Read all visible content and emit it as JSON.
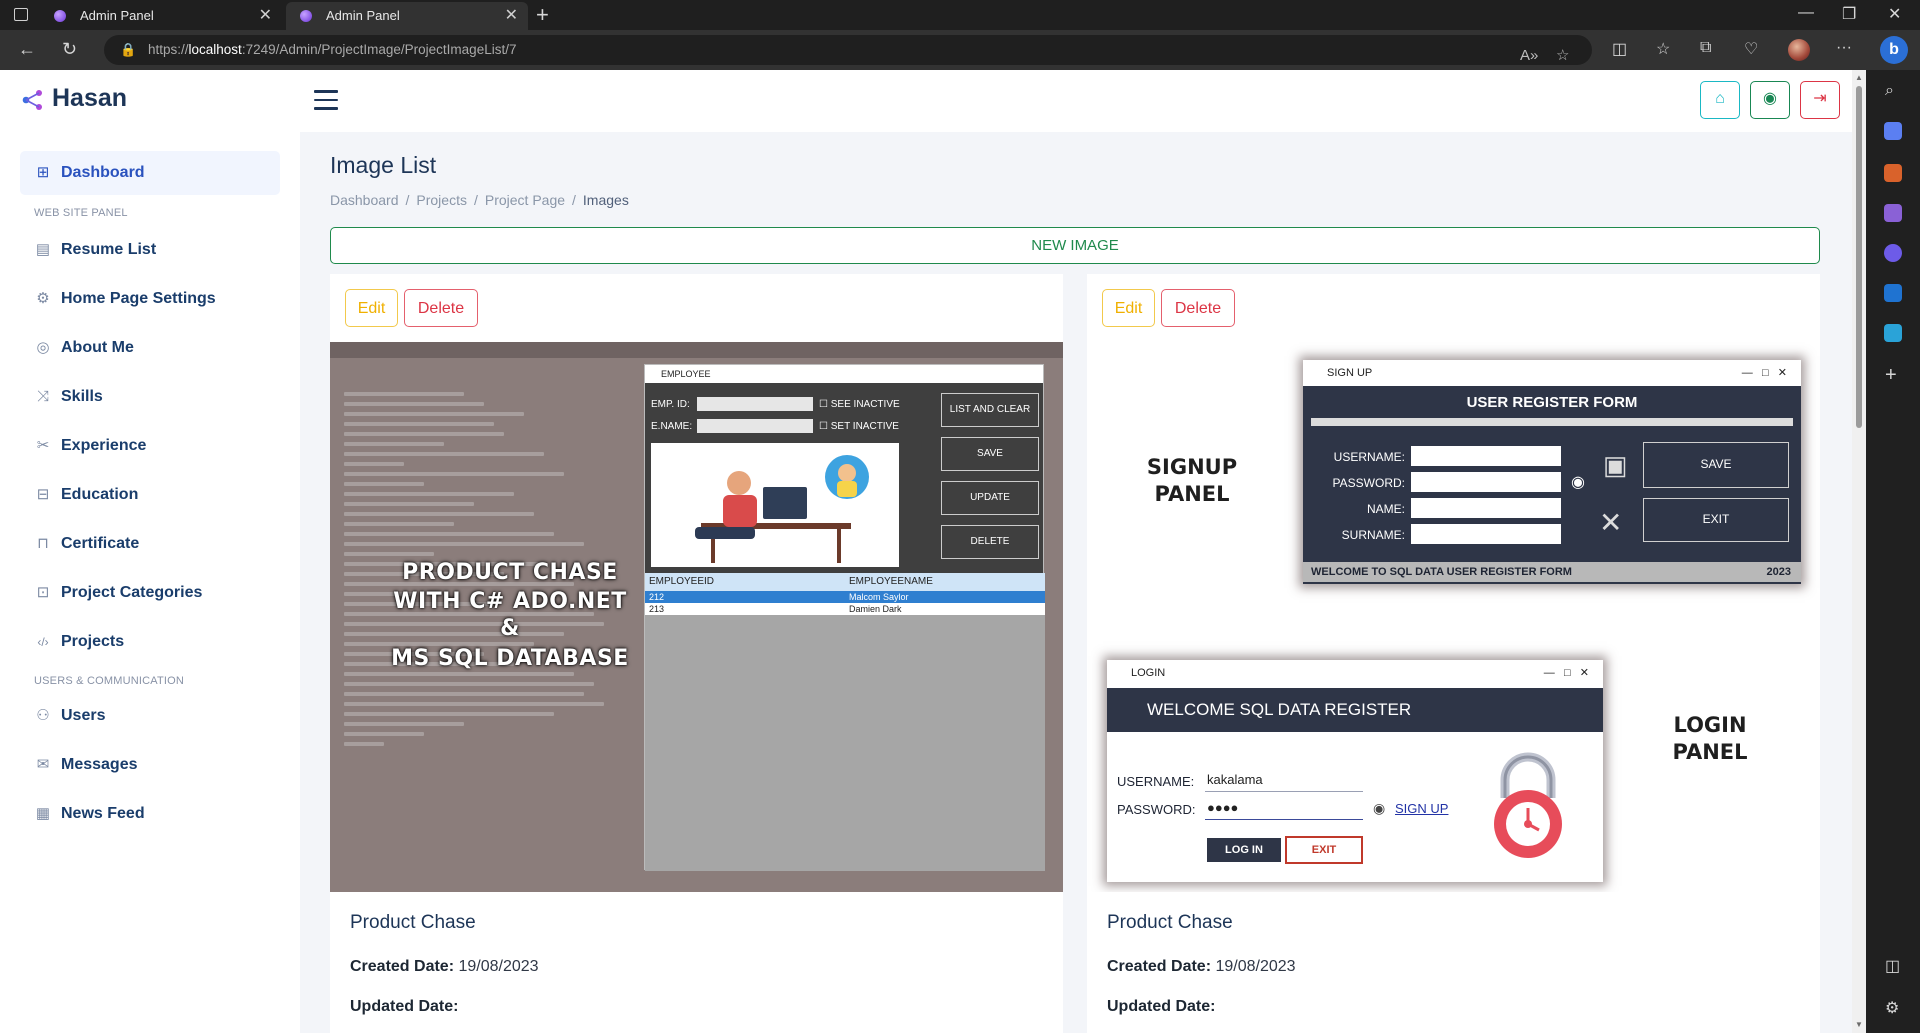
{
  "browser": {
    "tabs": [
      {
        "title": "Admin Panel",
        "active": false
      },
      {
        "title": "Admin Panel",
        "active": true
      }
    ],
    "url_scheme": "https://",
    "url_host": "localhost",
    "url_path": ":7249/Admin/ProjectImage/ProjectImageList/7",
    "icons": [
      "back-icon",
      "refresh-icon",
      "lock-icon",
      "read-aloud-icon",
      "favorite-icon",
      "split-screen-icon",
      "favorites-icon",
      "collections-icon",
      "performance-icon",
      "profile-avatar",
      "more-icon",
      "bing-icon"
    ]
  },
  "header": {
    "brand": "Hasan",
    "buttons": [
      {
        "name": "home-button",
        "icon": "home-icon",
        "color": "#1ab8c4",
        "glyph": "⌂"
      },
      {
        "name": "profile-button",
        "icon": "user-circle-icon",
        "color": "#198754",
        "glyph": "◉"
      },
      {
        "name": "logout-button",
        "icon": "logout-icon",
        "color": "#dc3545",
        "glyph": "⇥"
      }
    ]
  },
  "sidebar": {
    "dashboard": "Dashboard",
    "section_web": "WEB SITE PANEL",
    "web_items": [
      {
        "label": "Resume List",
        "icon": "resume-icon",
        "glyph": "▤"
      },
      {
        "label": "Home Page Settings",
        "icon": "gear-icon",
        "glyph": "⚙"
      },
      {
        "label": "About Me",
        "icon": "user-circle-icon",
        "glyph": "◎"
      },
      {
        "label": "Skills",
        "icon": "shuffle-icon",
        "glyph": "⤨"
      },
      {
        "label": "Experience",
        "icon": "tools-icon",
        "glyph": "✂"
      },
      {
        "label": "Education",
        "icon": "book-icon",
        "glyph": "⊟"
      },
      {
        "label": "Certificate",
        "icon": "bookmark-icon",
        "glyph": "⊓"
      },
      {
        "label": "Project Categories",
        "icon": "code-square-icon",
        "glyph": "⊡"
      },
      {
        "label": "Projects",
        "icon": "code-icon",
        "glyph": "‹/›"
      }
    ],
    "section_users": "USERS & COMMUNICATION",
    "user_items": [
      {
        "label": "Users",
        "icon": "users-icon",
        "glyph": "⚇"
      },
      {
        "label": "Messages",
        "icon": "envelope-icon",
        "glyph": "✉"
      },
      {
        "label": "News Feed",
        "icon": "newspaper-icon",
        "glyph": "▦"
      }
    ]
  },
  "main": {
    "title": "Image List",
    "breadcrumb": [
      "Dashboard",
      "Projects",
      "Project Page",
      "Images"
    ],
    "new_button": "NEW IMAGE",
    "cards": [
      {
        "edit": "Edit",
        "delete": "Delete",
        "title": "Product Chase",
        "created_label": "Created Date:",
        "created_value": "19/08/2023",
        "updated_label": "Updated Date:",
        "updated_value": "",
        "image": {
          "overlay_lines": [
            "PRODUCT CHASE",
            "WITH C# ADO.NET",
            "&",
            "MS SQL DATABASE"
          ],
          "window_title": "EMPLOYEE",
          "emp_id_label": "EMP. ID:",
          "ename_label": "E.NAME:",
          "see_inactive": "SEE INACTIVE",
          "set_inactive": "SET INACTIVE",
          "buttons": [
            "LIST AND CLEAR",
            "SAVE",
            "UPDATE",
            "DELETE"
          ],
          "grid_headers": [
            "EMPLOYEEID",
            "EMPLOYEENAME"
          ],
          "grid_rows": [
            [
              "212",
              "Malcom Saylor"
            ],
            [
              "213",
              "Damien Dark"
            ]
          ]
        }
      },
      {
        "edit": "Edit",
        "delete": "Delete",
        "title": "Product Chase",
        "created_label": "Created Date:",
        "created_value": "19/08/2023",
        "updated_label": "Updated Date:",
        "updated_value": "",
        "image": {
          "signup_caption": [
            "SIGNUP",
            "PANEL"
          ],
          "login_caption": [
            "LOGIN",
            "PANEL"
          ],
          "signup_title": "SIGN UP",
          "signup_header": "USER REGISTER FORM",
          "signup_fields": [
            "USERNAME:",
            "PASSWORD:",
            "NAME:",
            "SURNAME:"
          ],
          "signup_save": "SAVE",
          "signup_exit": "EXIT",
          "signup_footer": "WELCOME TO SQL DATA USER REGISTER FORM",
          "signup_year": "2023",
          "login_title": "LOGIN",
          "login_header": "WELCOME SQL DATA REGISTER",
          "login_username_label": "USERNAME:",
          "login_username_value": "kakalama",
          "login_password_label": "PASSWORD:",
          "login_password_value": "●●●●",
          "login_signup_link": "SIGN UP",
          "login_button": "LOG IN",
          "login_exit": "EXIT"
        }
      }
    ]
  }
}
